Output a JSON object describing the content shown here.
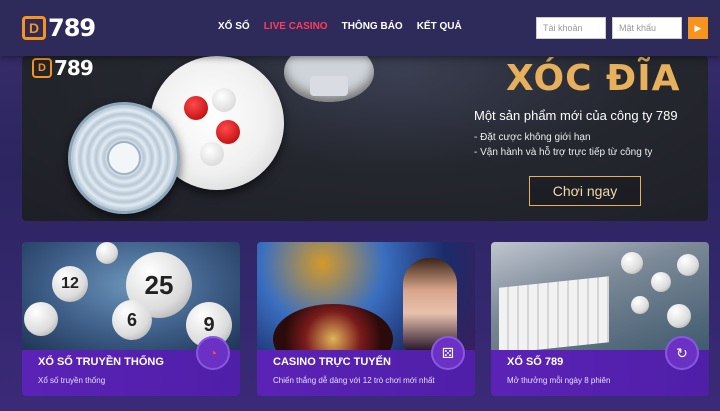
{
  "header": {
    "logo_mark": "D",
    "logo_text": "789",
    "nav": [
      {
        "label": "XỔ SỐ"
      },
      {
        "label": "LIVE CASINO"
      },
      {
        "label": "THÔNG BÁO"
      },
      {
        "label": "KẾT QUẢ"
      }
    ],
    "login": {
      "username_placeholder": "Tài khoản",
      "password_placeholder": "Mật khẩu",
      "submit_icon": "arrow-right-icon"
    },
    "colors": {
      "accent": "#f7941d",
      "active_nav": "#ff3c5a"
    }
  },
  "banner": {
    "logo_mark": "D",
    "logo_text": "789",
    "title": "XÓC ĐĨA",
    "subtitle": "Một sản phẩm mới của công ty 789",
    "bullets": [
      "- Đặt cược không giới hạn",
      "- Vận hành và hỗ trợ trực tiếp từ công ty"
    ],
    "cta": "Chơi ngay",
    "colors": {
      "title": "#e6b15a"
    }
  },
  "cards": [
    {
      "title": "XỔ SỐ TRUYỀN THỐNG",
      "desc": "Xổ số truyền thống",
      "icon": "spinner-icon"
    },
    {
      "title": "CASINO TRỰC TUYẾN",
      "desc": "Chiến thắng dễ dàng với 12 trò chơi mới nhất",
      "icon": "dice-icon"
    },
    {
      "title": "XỔ SỐ 789",
      "desc": "Mở thưởng mỗi ngày 8 phiên",
      "icon": "refresh-icon"
    }
  ],
  "lottery_balls": [
    "12",
    "25",
    "6",
    "9"
  ]
}
